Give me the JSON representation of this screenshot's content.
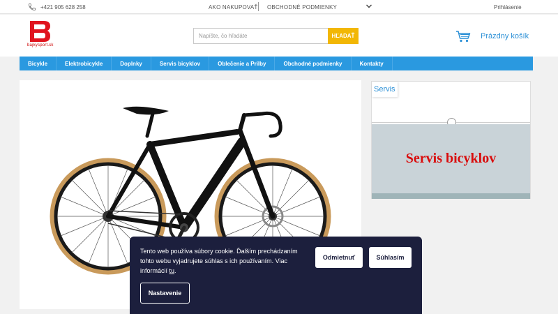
{
  "topbar": {
    "phone": "+421 905 628 258",
    "phone_icon": "phone-icon",
    "how_to_buy": "AKO NAKUPOVAŤ",
    "terms": "OBCHODNÉ PODMIENKY",
    "more_icon": "chevron-down-icon",
    "login": "Prihlásenie"
  },
  "header": {
    "logo_site": "bajkysport.sk",
    "search_placeholder": "Napíšte, čo hľadáte",
    "search_button": "HĽADAŤ",
    "cart_icon": "shopping-cart-icon",
    "cart_label": "Prázdny košík"
  },
  "nav": {
    "items": [
      "Bicykle",
      "Elektrobicykle",
      "Doplnky",
      "Servis bicyklov",
      "Oblečenie a Prilby",
      "Obchodné podmienky",
      "Kontakty"
    ]
  },
  "servis": {
    "tab_label": "Servis",
    "banner_text": "Servis bicyklov"
  },
  "cookie": {
    "message": "Tento web používa súbory cookie. Ďalším prechádzaním tohto webu vyjadrujete súhlas s ich používaním. Viac informácií",
    "link": "tu",
    "link_suffix": ".",
    "reject": "Odmietnuť",
    "accept": "Súhlasím",
    "settings": "Nastavenie"
  },
  "colors": {
    "accent_blue": "#2a99e0",
    "search_yellow": "#f2b705",
    "brand_red": "#d90c0c",
    "cookie_bg": "#1c1f3d"
  }
}
